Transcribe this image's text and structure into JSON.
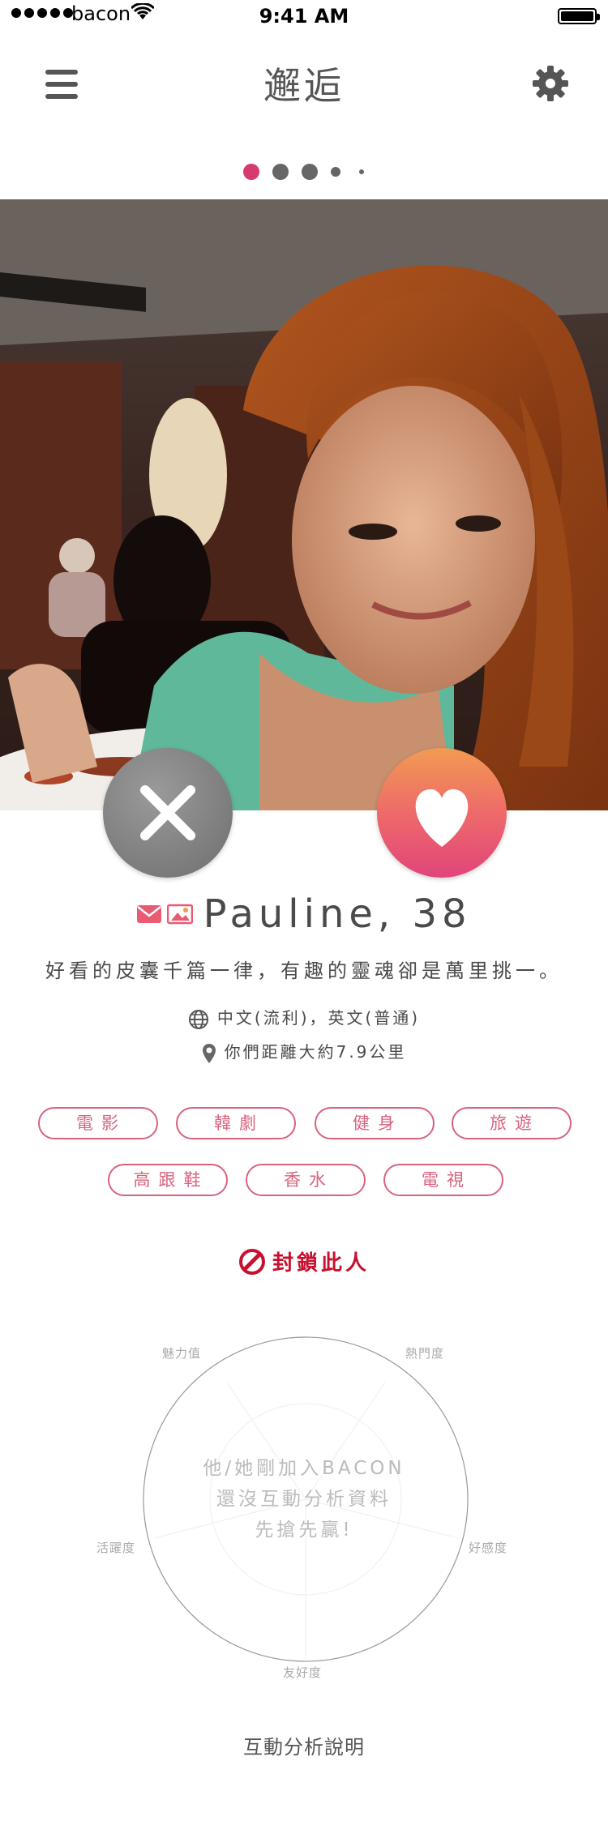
{
  "status_bar": {
    "carrier": "bacon",
    "time": "9:41 AM"
  },
  "header": {
    "title": "邂逅"
  },
  "pager": {
    "count": 5,
    "active": 0
  },
  "profile": {
    "name_age": "Pauline, 38",
    "bio": "好看的皮囊千篇一律，有趣的靈魂卻是萬里挑一。",
    "languages": "中文(流利)，英文(普通)",
    "distance": "你們距離大約7.9公里"
  },
  "tags": [
    "電影",
    "韓劇",
    "健身",
    "旅遊",
    "高跟鞋",
    "香水",
    "電視"
  ],
  "block": {
    "label": "封鎖此人"
  },
  "radar": {
    "labels": {
      "charm": "魅力值",
      "popularity": "熱門度",
      "favorability": "好感度",
      "friendliness": "友好度",
      "activity": "活躍度"
    },
    "message_lines": [
      "他/她剛加入BACON",
      "還沒互動分析資料",
      "先搶先贏!"
    ]
  },
  "footer": {
    "analysis_link": "互動分析說明"
  },
  "colors": {
    "accent": "#d8637e",
    "block_red": "#c8102e",
    "pager_active": "#d63a6e",
    "like_top": "#f29b52",
    "like_bottom": "#e0457a"
  }
}
